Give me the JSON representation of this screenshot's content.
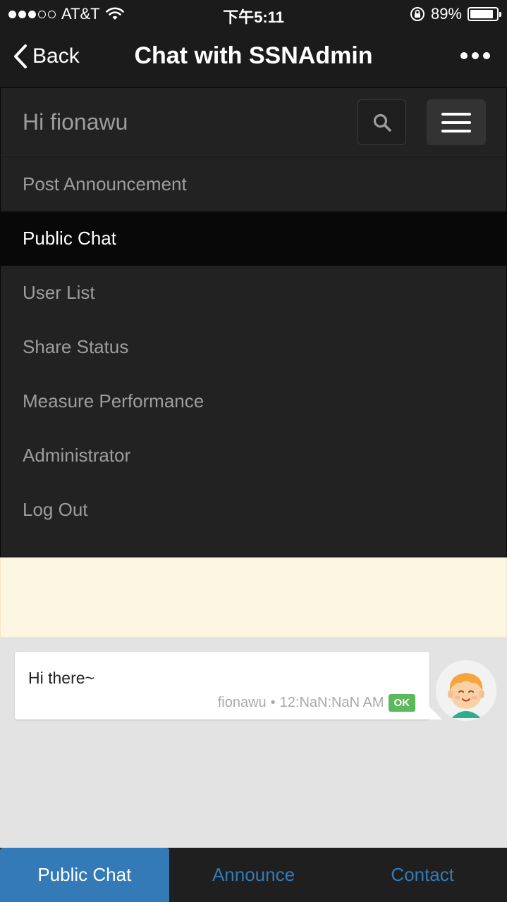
{
  "status_bar": {
    "carrier": "AT&T",
    "time": "下午5:11",
    "battery_percent": "89%",
    "battery_level": 0.89
  },
  "nav": {
    "back_label": "Back",
    "title": "Chat with SSNAdmin"
  },
  "header": {
    "greeting": "Hi fionawu"
  },
  "menu": {
    "items": [
      {
        "label": "Post Announcement"
      },
      {
        "label": "Public Chat"
      },
      {
        "label": "User List"
      },
      {
        "label": "Share Status"
      },
      {
        "label": "Measure Performance"
      },
      {
        "label": "Administrator"
      },
      {
        "label": "Log Out"
      }
    ]
  },
  "chat": {
    "messages": [
      {
        "text": "Hi there~",
        "author": "fionawu",
        "separator": "•",
        "timestamp": "12:NaN:NaN AM",
        "status": "OK"
      }
    ]
  },
  "tabs": [
    {
      "label": "Public Chat"
    },
    {
      "label": "Announce"
    },
    {
      "label": "Contact"
    }
  ],
  "colors": {
    "accent": "#337ab7",
    "ok": "#5cb85c",
    "navbar": "#222222",
    "notice": "#fcf5e2"
  }
}
